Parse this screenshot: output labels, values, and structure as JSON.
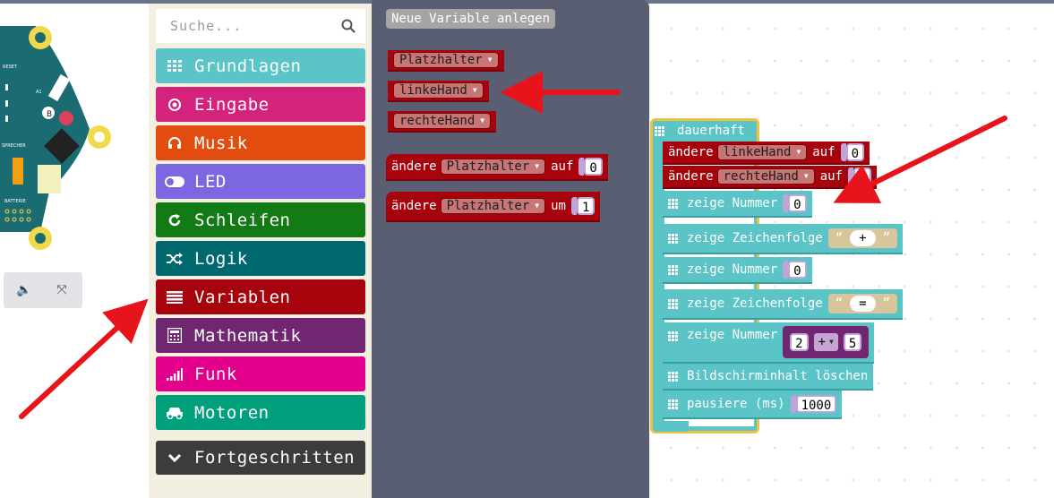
{
  "simulator": {
    "labels": {
      "reset": "RESET",
      "a1": "A1",
      "b": "B",
      "speaker": "SPRECHER",
      "battery": "BATTERIE"
    },
    "controls": {
      "sound_icon": "speaker-icon",
      "fullscreen_icon": "fullscreen-icon"
    }
  },
  "toolbox": {
    "search_placeholder": "Suche...",
    "categories": [
      {
        "label": "Grundlagen",
        "icon": "grid-icon",
        "color": "#5ac4c6"
      },
      {
        "label": "Eingabe",
        "icon": "target-icon",
        "color": "#d3237c"
      },
      {
        "label": "Musik",
        "icon": "headphones-icon",
        "color": "#e24c0e"
      },
      {
        "label": "LED",
        "icon": "toggle-icon",
        "color": "#7d67e0"
      },
      {
        "label": "Schleifen",
        "icon": "refresh-icon",
        "color": "#127b16"
      },
      {
        "label": "Logik",
        "icon": "shuffle-icon",
        "color": "#006970"
      },
      {
        "label": "Variablen",
        "icon": "list-icon",
        "color": "#a6030c"
      },
      {
        "label": "Mathematik",
        "icon": "calculator-icon",
        "color": "#712672"
      },
      {
        "label": "Funk",
        "icon": "signal-icon",
        "color": "#e3008c"
      },
      {
        "label": "Motoren",
        "icon": "car-icon",
        "color": "#00a07d"
      },
      {
        "label": "Fortgeschritten",
        "icon": "chevron-down-icon",
        "color": "#3c3c3c"
      }
    ]
  },
  "flyout": {
    "new_variable_label": "Neue Variable anlegen",
    "variables": [
      "Platzhalter",
      "linkeHand",
      "rechteHand"
    ],
    "set_block": {
      "verb": "ändere",
      "var": "Platzhalter",
      "prep": "auf",
      "value": "0"
    },
    "change_block": {
      "verb": "ändere",
      "var": "Platzhalter",
      "prep": "um",
      "value": "1"
    }
  },
  "workspace": {
    "forever_label": "dauerhaft",
    "set_left": {
      "verb": "ändere",
      "var": "linkeHand",
      "prep": "auf",
      "value": "0"
    },
    "set_right": {
      "verb": "ändere",
      "var": "rechteHand",
      "prep": "auf",
      "value": "0"
    },
    "show_number_1": {
      "label": "zeige Nummer",
      "value": "0"
    },
    "show_string_1": {
      "label": "zeige Zeichenfolge",
      "open_quote": "“",
      "value": "+",
      "close_quote": "”"
    },
    "show_number_2": {
      "label": "zeige Nummer",
      "value": "0"
    },
    "show_string_2": {
      "label": "zeige Zeichenfolge",
      "open_quote": "“",
      "value": "=",
      "close_quote": "”"
    },
    "show_number_3": {
      "label": "zeige Nummer",
      "left": "2",
      "op": "+",
      "right": "5"
    },
    "clear_screen": {
      "label": "Bildschirminhalt löschen"
    },
    "pause": {
      "label": "pausiere (ms)",
      "value": "1000"
    }
  },
  "colors": {
    "variables": "#a6030c",
    "basic": "#5ac4c6",
    "math": "#712672",
    "arrow": "#e8141b",
    "flyout_bg": "#595e72"
  }
}
